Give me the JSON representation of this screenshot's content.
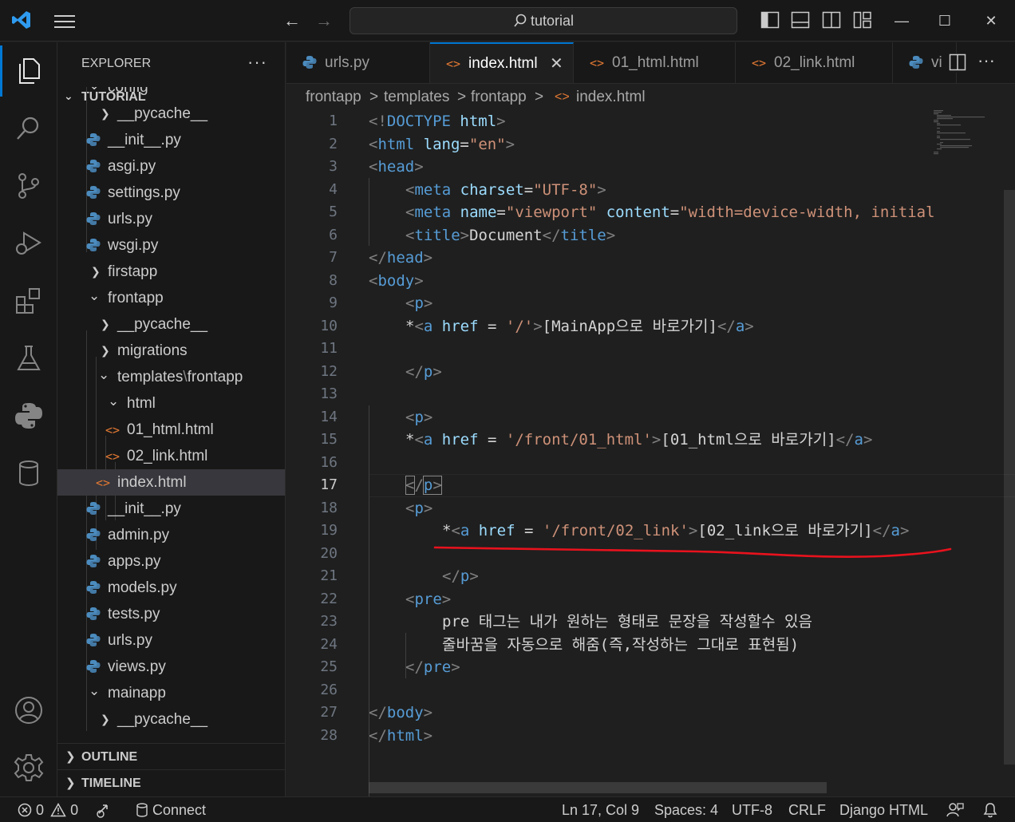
{
  "window": {
    "search_text": "tutorial",
    "accent": "#0078d4"
  },
  "sidebar": {
    "header": "EXPLORER",
    "more": "···",
    "root": "TUTORIAL",
    "items": [
      {
        "label": "config",
        "type": "folder-open"
      },
      {
        "label": "__pycache__",
        "type": "folder"
      },
      {
        "label": "__init__.py",
        "type": "python"
      },
      {
        "label": "asgi.py",
        "type": "python"
      },
      {
        "label": "settings.py",
        "type": "python"
      },
      {
        "label": "urls.py",
        "type": "python"
      },
      {
        "label": "wsgi.py",
        "type": "python"
      },
      {
        "label": "firstapp",
        "type": "folder"
      },
      {
        "label": "frontapp",
        "type": "folder-open"
      },
      {
        "label": "__pycache__",
        "type": "folder"
      },
      {
        "label": "migrations",
        "type": "folder"
      },
      {
        "label": "templates",
        "sep": "\\",
        "label2": "frontapp",
        "type": "folder-open"
      },
      {
        "label": "html",
        "type": "folder-open"
      },
      {
        "label": "01_html.html",
        "type": "html"
      },
      {
        "label": "02_link.html",
        "type": "html"
      },
      {
        "label": "index.html",
        "type": "html"
      },
      {
        "label": "__init__.py",
        "type": "python"
      },
      {
        "label": "admin.py",
        "type": "python"
      },
      {
        "label": "apps.py",
        "type": "python"
      },
      {
        "label": "models.py",
        "type": "python"
      },
      {
        "label": "tests.py",
        "type": "python"
      },
      {
        "label": "urls.py",
        "type": "python"
      },
      {
        "label": "views.py",
        "type": "python"
      },
      {
        "label": "mainapp",
        "type": "folder-open"
      },
      {
        "label": "__pycache__",
        "type": "folder"
      }
    ],
    "outline": "OUTLINE",
    "timeline": "TIMELINE"
  },
  "tabs": [
    {
      "label": "urls.py",
      "type": "python"
    },
    {
      "label": "index.html",
      "type": "html",
      "close": "✕"
    },
    {
      "label": "01_html.html",
      "type": "html"
    },
    {
      "label": "02_link.html",
      "type": "html"
    },
    {
      "label": "vi",
      "type": "python"
    }
  ],
  "breadcrumbs": [
    "frontapp",
    "templates",
    "frontapp",
    "index.html"
  ],
  "breadcrumb_sep": ">",
  "editor": {
    "current_line": 17,
    "lines": [
      "1",
      "2",
      "3",
      "4",
      "5",
      "6",
      "7",
      "8",
      "9",
      "10",
      "11",
      "12",
      "13",
      "14",
      "15",
      "16",
      "17",
      "18",
      "19",
      "20",
      "21",
      "22",
      "23",
      "24",
      "25",
      "26",
      "27",
      "28"
    ],
    "code": {
      "l1": [
        "<!",
        "DOCTYPE",
        " html",
        ">"
      ],
      "l2": [
        "<",
        "html",
        " lang",
        "=",
        "\"en\"",
        ">"
      ],
      "l3": [
        "<",
        "head",
        ">"
      ],
      "l4": [
        "<",
        "meta",
        " charset",
        "=",
        "\"UTF-8\"",
        ">"
      ],
      "l5": [
        "<",
        "meta",
        " name",
        "=",
        "\"viewport\"",
        " content",
        "=",
        "\"width=device-width, initial"
      ],
      "l6": [
        "<",
        "title",
        ">",
        "Document",
        "</",
        "title",
        ">"
      ],
      "l7": [
        "</",
        "head",
        ">"
      ],
      "l8": [
        "<",
        "body",
        ">"
      ],
      "l9": [
        "<",
        "p",
        ">"
      ],
      "l10": [
        "*",
        "<",
        "a",
        " href",
        " = ",
        "'/'",
        ">",
        "[MainApp으로 바로가기]",
        "</",
        "a",
        ">"
      ],
      "l12": [
        "</",
        "p",
        ">"
      ],
      "l14": [
        "<",
        "p",
        ">"
      ],
      "l15": [
        "*",
        "<",
        "a",
        " href",
        " = ",
        "'/front/01_html'",
        ">",
        "[01_html으로 바로가기]",
        "</",
        "a",
        ">"
      ],
      "l17": [
        "</",
        "p",
        ">"
      ],
      "l18": [
        "<",
        "p",
        ">"
      ],
      "l19": [
        "*",
        "<",
        "a",
        " href",
        " = ",
        "'/front/02_link'",
        ">",
        "[02_link으로 바로가기]",
        "</",
        "a",
        ">"
      ],
      "l21": [
        "</",
        "p",
        ">"
      ],
      "l22": [
        "<",
        "pre",
        ">"
      ],
      "l23": "pre 태그는 내가 원하는 형태로 문장을 작성할수 있음",
      "l24": "줄바꿈을 자동으로 해줌(즉,작성하는 그대로 표현됨)",
      "l25": [
        "</",
        "pre",
        ">"
      ],
      "l27": [
        "</",
        "body",
        ">"
      ],
      "l28": [
        "</",
        "html",
        ">"
      ]
    },
    "annotation_color": "#e8121d"
  },
  "status": {
    "errors": "0",
    "warnings": "0",
    "connect": "Connect",
    "position": "Ln 17, Col 9",
    "spaces": "Spaces: 4",
    "encoding": "UTF-8",
    "eol": "CRLF",
    "language": "Django HTML"
  }
}
